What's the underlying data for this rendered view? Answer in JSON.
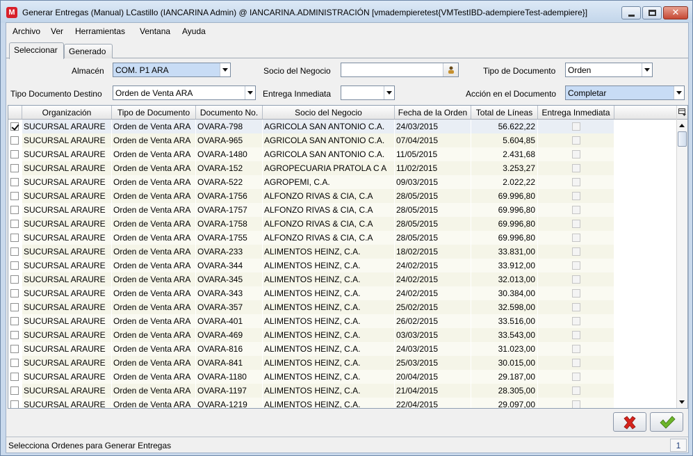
{
  "window": {
    "title": "Generar Entregas (Manual)  LCastillo (IANCARINA Admin) @ IANCARINA.ADMINISTRACIÓN [vmadempieretest{VMTestIBD-adempiereTest-adempiere}]",
    "app_icon_text": "M"
  },
  "menu": {
    "items": [
      "Archivo",
      "Ver",
      "Herramientas",
      "Ventana",
      "Ayuda"
    ]
  },
  "tabs": [
    {
      "label": "Seleccionar",
      "active": true
    },
    {
      "label": "Generado",
      "active": false
    }
  ],
  "form": {
    "almacen_label": "Almacén",
    "almacen_value": "COM. P1 ARA",
    "socio_label": "Socio del Negocio",
    "socio_value": "",
    "tipo_doc_label": "Tipo de Documento",
    "tipo_doc_value": "Orden",
    "tipo_doc_destino_label": "Tipo Documento Destino",
    "tipo_doc_destino_value": "Orden de Venta ARA",
    "entrega_inmediata_label": "Entrega Inmediata",
    "entrega_inmediata_value": "",
    "accion_label": "Acción en el Documento",
    "accion_value": "Completar"
  },
  "table": {
    "columns": [
      "",
      "Organización",
      "Tipo de Documento",
      "Documento No.",
      "Socio del Negocio",
      "Fecha de la Orden",
      "Total de Líneas",
      "Entrega Inmediata"
    ],
    "rows": [
      {
        "checked": true,
        "org": "SUCURSAL ARAURE",
        "tipo": "Orden de Venta ARA",
        "doc": "OVARA-798",
        "socio": "AGRICOLA SAN ANTONIO  C.A.",
        "fecha": "24/03/2015",
        "total": "56.622,22"
      },
      {
        "checked": false,
        "org": "SUCURSAL ARAURE",
        "tipo": "Orden de Venta ARA",
        "doc": "OVARA-965",
        "socio": "AGRICOLA SAN ANTONIO  C.A.",
        "fecha": "07/04/2015",
        "total": "5.604,85"
      },
      {
        "checked": false,
        "org": "SUCURSAL ARAURE",
        "tipo": "Orden de Venta ARA",
        "doc": "OVARA-1480",
        "socio": "AGRICOLA SAN ANTONIO  C.A.",
        "fecha": "11/05/2015",
        "total": "2.431,68"
      },
      {
        "checked": false,
        "org": "SUCURSAL ARAURE",
        "tipo": "Orden de Venta ARA",
        "doc": "OVARA-152",
        "socio": "AGROPECUARIA PRATOLA  C A",
        "fecha": "11/02/2015",
        "total": "3.253,27"
      },
      {
        "checked": false,
        "org": "SUCURSAL ARAURE",
        "tipo": "Orden de Venta ARA",
        "doc": "OVARA-522",
        "socio": "AGROPEMI,  C.A.",
        "fecha": "09/03/2015",
        "total": "2.022,22"
      },
      {
        "checked": false,
        "org": "SUCURSAL ARAURE",
        "tipo": "Orden de Venta ARA",
        "doc": "OVARA-1756",
        "socio": "ALFONZO RIVAS & CIA, C.A",
        "fecha": "28/05/2015",
        "total": "69.996,80"
      },
      {
        "checked": false,
        "org": "SUCURSAL ARAURE",
        "tipo": "Orden de Venta ARA",
        "doc": "OVARA-1757",
        "socio": "ALFONZO RIVAS & CIA, C.A",
        "fecha": "28/05/2015",
        "total": "69.996,80"
      },
      {
        "checked": false,
        "org": "SUCURSAL ARAURE",
        "tipo": "Orden de Venta ARA",
        "doc": "OVARA-1758",
        "socio": "ALFONZO RIVAS & CIA, C.A",
        "fecha": "28/05/2015",
        "total": "69.996,80"
      },
      {
        "checked": false,
        "org": "SUCURSAL ARAURE",
        "tipo": "Orden de Venta ARA",
        "doc": "OVARA-1755",
        "socio": "ALFONZO RIVAS & CIA, C.A",
        "fecha": "28/05/2015",
        "total": "69.996,80"
      },
      {
        "checked": false,
        "org": "SUCURSAL ARAURE",
        "tipo": "Orden de Venta ARA",
        "doc": "OVARA-233",
        "socio": "ALIMENTOS HEINZ,  C.A.",
        "fecha": "18/02/2015",
        "total": "33.831,00"
      },
      {
        "checked": false,
        "org": "SUCURSAL ARAURE",
        "tipo": "Orden de Venta ARA",
        "doc": "OVARA-344",
        "socio": "ALIMENTOS HEINZ,  C.A.",
        "fecha": "24/02/2015",
        "total": "33.912,00"
      },
      {
        "checked": false,
        "org": "SUCURSAL ARAURE",
        "tipo": "Orden de Venta ARA",
        "doc": "OVARA-345",
        "socio": "ALIMENTOS HEINZ,  C.A.",
        "fecha": "24/02/2015",
        "total": "32.013,00"
      },
      {
        "checked": false,
        "org": "SUCURSAL ARAURE",
        "tipo": "Orden de Venta ARA",
        "doc": "OVARA-343",
        "socio": "ALIMENTOS HEINZ,  C.A.",
        "fecha": "24/02/2015",
        "total": "30.384,00"
      },
      {
        "checked": false,
        "org": "SUCURSAL ARAURE",
        "tipo": "Orden de Venta ARA",
        "doc": "OVARA-357",
        "socio": "ALIMENTOS HEINZ,  C.A.",
        "fecha": "25/02/2015",
        "total": "32.598,00"
      },
      {
        "checked": false,
        "org": "SUCURSAL ARAURE",
        "tipo": "Orden de Venta ARA",
        "doc": "OVARA-401",
        "socio": "ALIMENTOS HEINZ,  C.A.",
        "fecha": "26/02/2015",
        "total": "33.516,00"
      },
      {
        "checked": false,
        "org": "SUCURSAL ARAURE",
        "tipo": "Orden de Venta ARA",
        "doc": "OVARA-469",
        "socio": "ALIMENTOS HEINZ,  C.A.",
        "fecha": "03/03/2015",
        "total": "33.543,00"
      },
      {
        "checked": false,
        "org": "SUCURSAL ARAURE",
        "tipo": "Orden de Venta ARA",
        "doc": "OVARA-816",
        "socio": "ALIMENTOS HEINZ,  C.A.",
        "fecha": "24/03/2015",
        "total": "31.023,00"
      },
      {
        "checked": false,
        "org": "SUCURSAL ARAURE",
        "tipo": "Orden de Venta ARA",
        "doc": "OVARA-841",
        "socio": "ALIMENTOS HEINZ,  C.A.",
        "fecha": "25/03/2015",
        "total": "30.015,00"
      },
      {
        "checked": false,
        "org": "SUCURSAL ARAURE",
        "tipo": "Orden de Venta ARA",
        "doc": "OVARA-1180",
        "socio": "ALIMENTOS HEINZ,  C.A.",
        "fecha": "20/04/2015",
        "total": "29.187,00"
      },
      {
        "checked": false,
        "org": "SUCURSAL ARAURE",
        "tipo": "Orden de Venta ARA",
        "doc": "OVARA-1197",
        "socio": "ALIMENTOS HEINZ,  C.A.",
        "fecha": "21/04/2015",
        "total": "28.305,00"
      },
      {
        "checked": false,
        "org": "SUCURSAL ARAURE",
        "tipo": "Orden de Venta ARA",
        "doc": "OVARA-1219",
        "socio": "ALIMENTOS HEINZ,  C.A.",
        "fecha": "22/04/2015",
        "total": "29.097,00"
      }
    ]
  },
  "status": {
    "text": "Selecciona Ordenes para Generar Entregas",
    "count": "1"
  },
  "colors": {
    "selected_field": "#c8dcf5",
    "cancel_red": "#d6231c",
    "ok_green": "#6cb52a"
  },
  "icons": [
    "app-logo-icon",
    "minimize-icon",
    "maximize-icon",
    "close-icon",
    "lookup-icon",
    "column-control-icon",
    "cancel-x-icon",
    "ok-check-icon"
  ]
}
